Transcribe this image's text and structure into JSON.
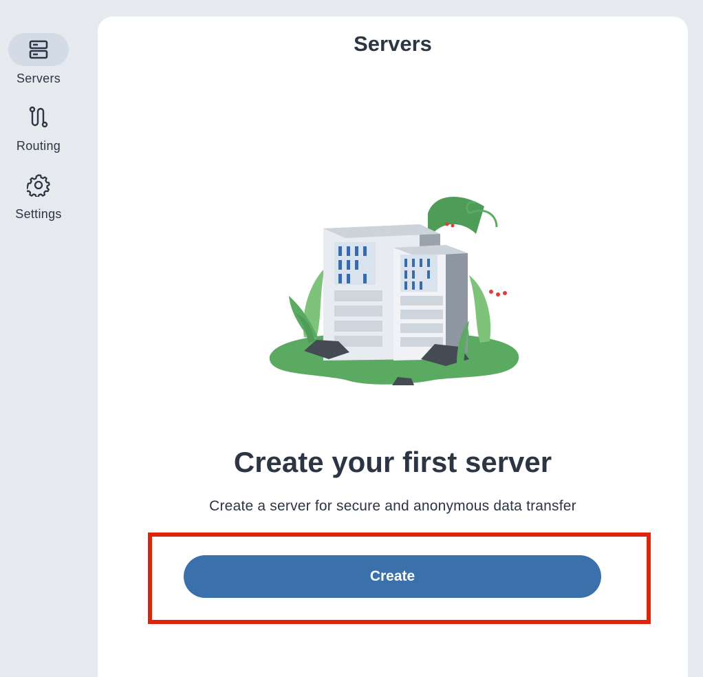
{
  "sidebar": {
    "items": [
      {
        "label": "Servers",
        "icon": "server-icon",
        "active": true
      },
      {
        "label": "Routing",
        "icon": "routing-icon",
        "active": false
      },
      {
        "label": "Settings",
        "icon": "gear-icon",
        "active": false
      }
    ]
  },
  "header": {
    "title": "Servers"
  },
  "empty_state": {
    "illustration": "servers-illustration",
    "title": "Create your first server",
    "subtitle": "Create a server for secure and anonymous data transfer",
    "create_label": "Create"
  },
  "colors": {
    "background": "#e6e9ee",
    "card": "#ffffff",
    "active_pill": "#d3dce6",
    "primary_button": "#3a71aa",
    "text": "#2b3544",
    "highlight_border": "#e0240c"
  }
}
